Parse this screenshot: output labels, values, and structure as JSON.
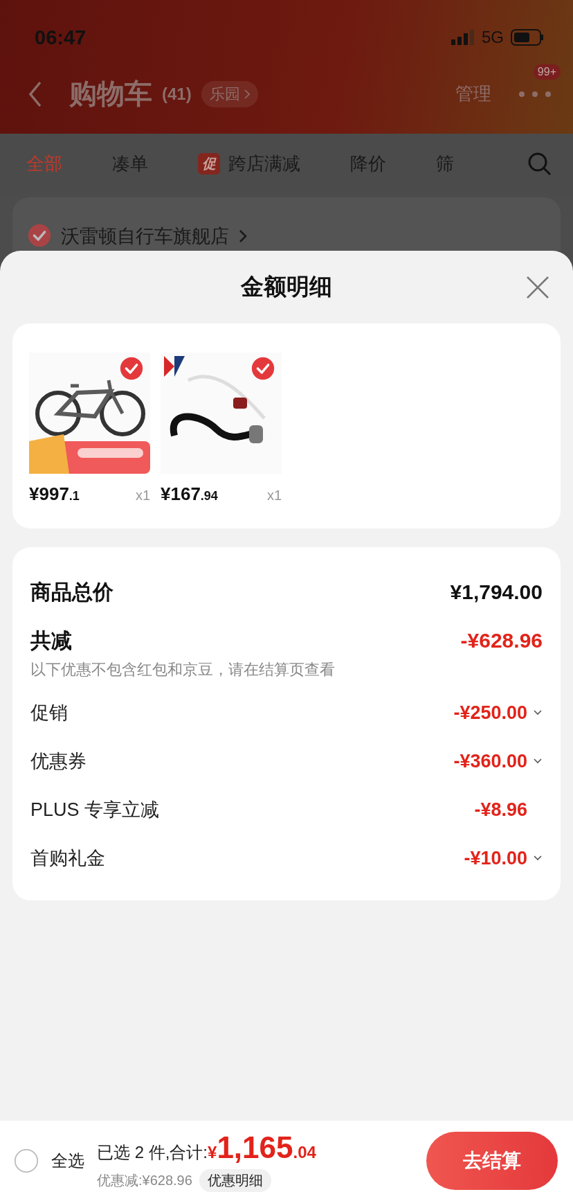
{
  "status_bar": {
    "time": "06:47",
    "network": "5G"
  },
  "nav": {
    "title": "购物车",
    "count": "(41)",
    "tag": "乐园",
    "manage": "管理",
    "badge": "99+"
  },
  "filter_tabs": [
    {
      "label": "全部",
      "selected": true
    },
    {
      "label": "凑单",
      "selected": false
    },
    {
      "label": "跨店满减",
      "selected": false,
      "badge": "促"
    },
    {
      "label": "降价",
      "selected": false
    },
    {
      "label": "筛",
      "selected": false
    }
  ],
  "store": {
    "name": "沃雷顿自行车旗舰店",
    "checked": true
  },
  "sheet": {
    "title": "金额明细"
  },
  "items": [
    {
      "kind": "bicycle",
      "price": "¥997",
      "price_decimal": ".1",
      "quantity": "x1",
      "checked": true
    },
    {
      "kind": "rope",
      "price": "¥167",
      "price_decimal": ".94",
      "quantity": "x1",
      "checked": true
    }
  ],
  "summary": {
    "total_label": "商品总价",
    "total": "¥1,794.00",
    "discount_label": "共减",
    "discount": "-¥628.96",
    "note": "以下优惠不包含红包和京豆，请在结算页查看"
  },
  "discounts": [
    {
      "label": "促销",
      "amount": "-¥250.00",
      "expandable": true
    },
    {
      "label": "优惠券",
      "amount": "-¥360.00",
      "expandable": true
    },
    {
      "label": "PLUS 专享立减",
      "amount": "-¥8.96",
      "expandable": false
    },
    {
      "label": "首购礼金",
      "amount": "-¥10.00",
      "expandable": true
    }
  ],
  "footer": {
    "select_all": "全选",
    "checked": false,
    "selected_text": "已选 2 件,合计:",
    "currency": "¥",
    "total": "1,165",
    "total_decimal": ".04",
    "saved": "优惠减:¥628.96",
    "detail_button": "优惠明细",
    "checkout": "去结算"
  }
}
